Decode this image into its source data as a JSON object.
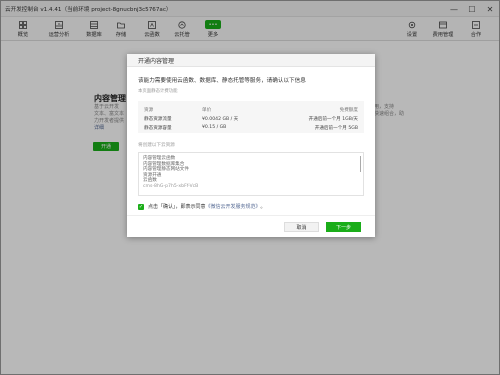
{
  "window": {
    "title": "云开发控制台 v1.4.41（当前环境 project-8gnucbnj3c5767ac）",
    "controls": [
      "—",
      "☐",
      "✕"
    ]
  },
  "toolbar": {
    "items": [
      {
        "label": "概览",
        "icon": "grid-icon"
      },
      {
        "label": "运营分析",
        "icon": "chart-icon"
      },
      {
        "label": "数据库",
        "icon": "database-icon"
      },
      {
        "label": "存储",
        "icon": "folder-icon"
      },
      {
        "label": "云函数",
        "icon": "function-icon"
      },
      {
        "label": "云托管",
        "icon": "cloud-icon"
      },
      {
        "label": "更多",
        "icon": "more-icon"
      },
      {
        "label": "设置",
        "icon": "gear-icon"
      },
      {
        "label": "费用管理",
        "icon": "billing-icon"
      },
      {
        "label": "合作",
        "icon": "handshake-icon"
      }
    ],
    "more_badge": "•••"
  },
  "background": {
    "title": "内容管理",
    "desc_lines": [
      "基于云开发",
      "文本、富文本",
      "力开发者提供",
      "详细"
    ],
    "button": "开通",
    "right_lines": [
      "使用，支持",
      "能快速组合，助"
    ]
  },
  "dialog": {
    "title": "开通内容管理",
    "intro": "该能力需要使用云函数、数据库、静态托管等服务，请确认以下信息",
    "sub": "本页面静态计费功能",
    "pricing": {
      "headers": [
        "资源",
        "单价",
        "免费额度"
      ],
      "rows": [
        {
          "resource": "静态资源流量",
          "price": "¥0.0042 GB / 天",
          "free": "开通后前一个月 1GB/天"
        },
        {
          "resource": "静态资源容量",
          "price": "¥0.15 / GB",
          "free": "开通后前一个月 5GB"
        }
      ]
    },
    "resources_label": "将创建以下云资源",
    "resources": [
      "内容管理云函数",
      "内容管理数据库集合",
      "内容管理静态网站文件",
      "资源开通",
      "云函数"
    ],
    "env_id": "cms-8hG-p7h5-xbFf-VcB",
    "agree_prefix": "点击「确认」，即表示同意",
    "agree_link": "《微信云开发服务规范》",
    "agree_suffix": "。",
    "cancel": "取消",
    "next": "下一步"
  }
}
